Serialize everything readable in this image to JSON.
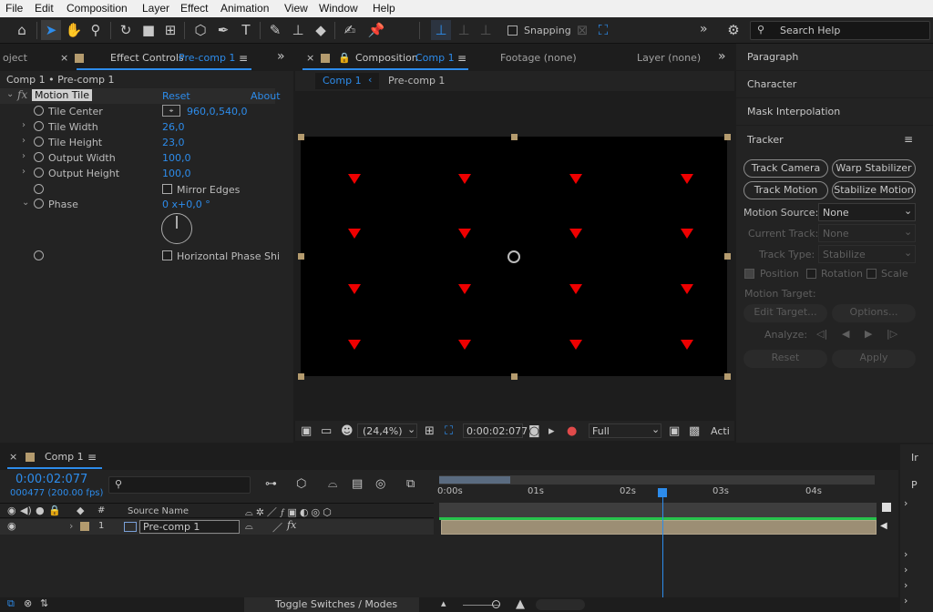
{
  "menu": [
    "File",
    "Edit",
    "Composition",
    "Layer",
    "Effect",
    "Animation",
    "View",
    "Window",
    "Help"
  ],
  "toolbar": {
    "snapping_label": "Snapping",
    "search_placeholder": "Search Help",
    "more": "»"
  },
  "project_tab": {
    "label": "oject"
  },
  "effect_controls": {
    "tab_prefix": "Effect Controls",
    "tab_target": "Pre-comp 1",
    "breadcrumb": "Comp 1 • Pre-comp 1",
    "effect_name": "Motion Tile",
    "reset": "Reset",
    "about": "About",
    "fx": "fx",
    "props": [
      {
        "name": "Tile Center",
        "value": "960,0,540,0"
      },
      {
        "name": "Tile Width",
        "value": "26,0"
      },
      {
        "name": "Tile Height",
        "value": "23,0"
      },
      {
        "name": "Output Width",
        "value": "100,0"
      },
      {
        "name": "Output Height",
        "value": "100,0"
      },
      {
        "name": "",
        "value": "Mirror Edges"
      },
      {
        "name": "Phase",
        "value": "0 x+0,0 °"
      },
      {
        "name": "",
        "value": "Horizontal Phase Shi"
      }
    ]
  },
  "composition": {
    "tab_prefix": "Composition",
    "tab_target": "Comp 1",
    "footage_tab": "Footage  (none)",
    "layer_tab": "Layer  (none)",
    "breadcrumb_active": "Comp 1",
    "breadcrumb_next": "Pre-comp 1",
    "zoom": "(24,4%)",
    "timecode": "0:00:02:077",
    "resolution": "Full",
    "active": "Acti"
  },
  "right_panels": {
    "sections": [
      "Paragraph",
      "Character",
      "Mask Interpolation"
    ],
    "tracker": {
      "title": "Tracker",
      "track_camera": "Track Camera",
      "warp_stabilizer": "Warp Stabilizer",
      "track_motion": "Track Motion",
      "stabilize_motion": "Stabilize Motion",
      "motion_source_label": "Motion Source:",
      "motion_source_value": "None",
      "current_track_label": "Current Track:",
      "current_track_value": "None",
      "track_type_label": "Track Type:",
      "track_type_value": "Stabilize",
      "position": "Position",
      "rotation": "Rotation",
      "scale": "Scale",
      "motion_target": "Motion Target:",
      "edit_target": "Edit Target...",
      "options": "Options...",
      "analyze": "Analyze:",
      "reset": "Reset",
      "apply": "Apply"
    }
  },
  "timeline": {
    "tab": "Comp 1",
    "timecode": "0:00:02:077",
    "frames": "000477 (200.00 fps)",
    "search_placeholder": "",
    "source_name_header": "Source Name",
    "hash_header": "#",
    "layer_number": "1",
    "layer_name": "Pre-comp 1",
    "ruler": [
      "0:00s",
      "01s",
      "02s",
      "03s",
      "04s"
    ],
    "toggle": "Toggle Switches / Modes",
    "playhead_seconds": 2.39,
    "duration_seconds": 4.8
  },
  "side_strip": [
    "Ir",
    "P"
  ]
}
